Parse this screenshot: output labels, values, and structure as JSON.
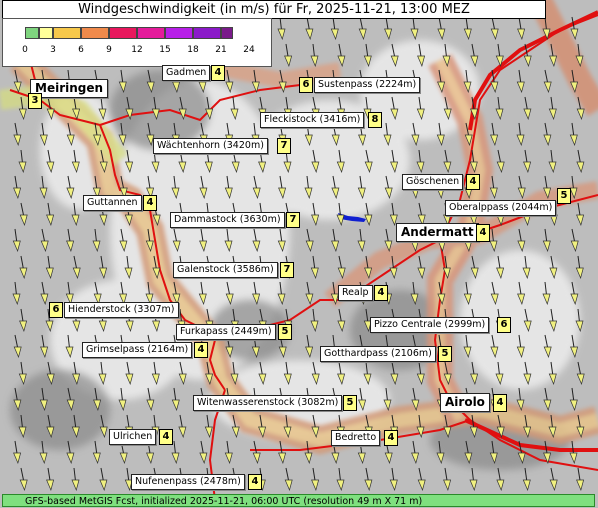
{
  "title": "Windgeschwindigkeit (in m/s) für Fr, 2025-11-21, 13:00 MEZ",
  "legend": {
    "ticks": [
      "0",
      "3",
      "6",
      "9",
      "12",
      "15",
      "18",
      "21",
      "24"
    ],
    "colors": [
      "#7fd47f",
      "#ffff99",
      "#f7c84a",
      "#f08a4b",
      "#e8175d",
      "#e41b9b",
      "#b71fe8",
      "#8b1ac9",
      "#7a1a8a"
    ]
  },
  "locations": [
    {
      "name": "Gadmen",
      "value": "4"
    },
    {
      "name": "Meiringen",
      "value": "3"
    },
    {
      "name": "Sustenpass (2224m)",
      "value": "6"
    },
    {
      "name": "Fleckistock (3416m)",
      "value": "8"
    },
    {
      "name": "Wächtenhorn (3420m)",
      "value": "7"
    },
    {
      "name": "Göschenen",
      "value": "4"
    },
    {
      "name": "Guttannen",
      "value": "4"
    },
    {
      "name": "Oberalppass (2044m)",
      "value": "5"
    },
    {
      "name": "Dammastock (3630m)",
      "value": "7"
    },
    {
      "name": "Andermatt",
      "value": "4"
    },
    {
      "name": "Galenstock (3586m)",
      "value": "7"
    },
    {
      "name": "Realp",
      "value": "4"
    },
    {
      "name": "Hienderstock (3307m)",
      "value": "6"
    },
    {
      "name": "Pizzo Centrale (2999m)",
      "value": "6"
    },
    {
      "name": "Furkapass (2449m)",
      "value": "5"
    },
    {
      "name": "Grimselpass (2164m)",
      "value": "4"
    },
    {
      "name": "Gotthardpass (2106m)",
      "value": "5"
    },
    {
      "name": "Witenwasserenstock (3082m)",
      "value": "5"
    },
    {
      "name": "Airolo",
      "value": "4"
    },
    {
      "name": "Ulrichen",
      "value": "4"
    },
    {
      "name": "Bedretto",
      "value": "4"
    },
    {
      "name": "Nufenenpass (2478m)",
      "value": "4"
    }
  ],
  "wind_arrow_color": "#f0f080",
  "road_color": "#e01010",
  "footer": "GFS-based MetGIS Fcst, initialized 2025-11-21, 06:00 UTC  (resolution 49 m X 71 m)"
}
